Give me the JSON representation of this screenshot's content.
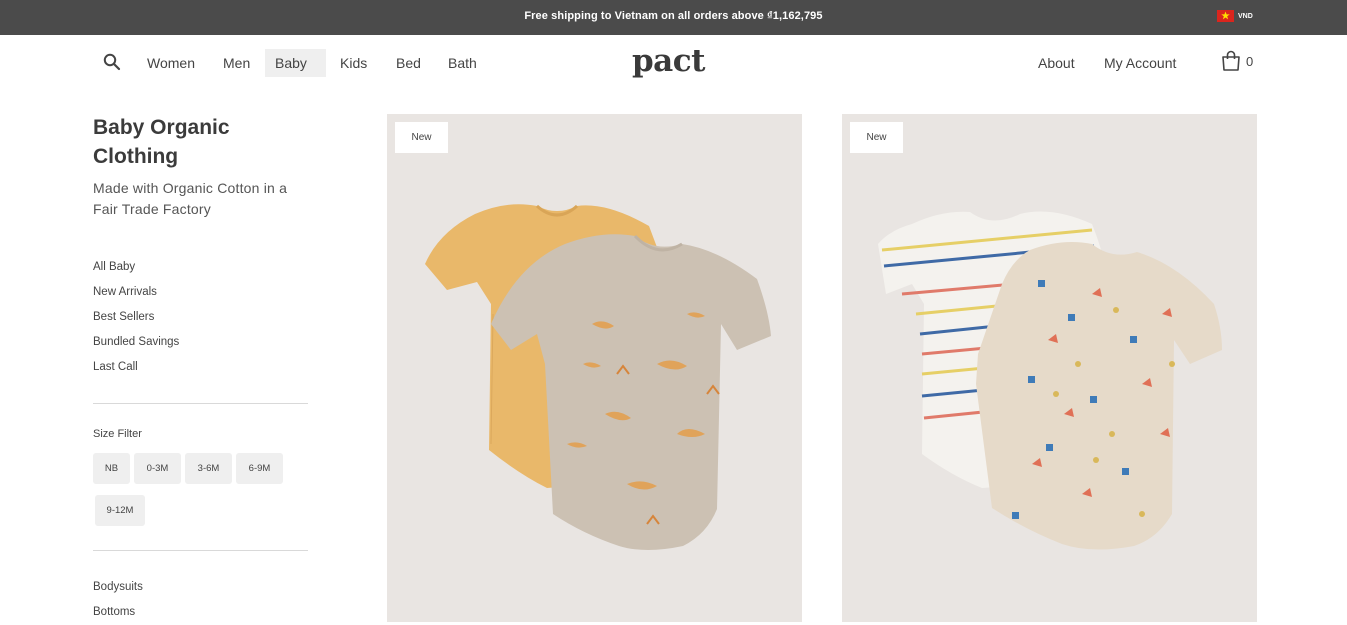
{
  "announcement": {
    "text": "Free shipping to Vietnam on all orders above ₫1,162,795",
    "currency": "VND"
  },
  "nav": {
    "left_items": [
      {
        "label": "Women"
      },
      {
        "label": "Men"
      },
      {
        "label": "Baby",
        "active": true
      },
      {
        "label": "Kids"
      },
      {
        "label": "Bed"
      },
      {
        "label": "Bath"
      }
    ],
    "logo": "pact",
    "about": "About",
    "account": "My Account",
    "cart_count": "0"
  },
  "sidebar": {
    "title": "Baby Organic Clothing",
    "subtitle": "Made with Organic Cotton in a Fair Trade Factory",
    "categories": [
      "All Baby",
      "New Arrivals",
      "Best Sellers",
      "Bundled Savings",
      "Last Call"
    ],
    "size_filter_label": "Size Filter",
    "sizes": [
      "NB",
      "0-3M",
      "3-6M",
      "6-9M",
      "9-12M"
    ],
    "sub_categories": [
      "Bodysuits",
      "Bottoms"
    ]
  },
  "products": [
    {
      "badge": "New",
      "colors": [
        "#e8b970",
        "#cbbfb1"
      ]
    },
    {
      "badge": "New",
      "colors": [
        "#f3f1ec",
        "#e6d9c8"
      ]
    }
  ],
  "colors": {
    "topbar_bg": "#4b4b4b",
    "card_bg": "#e9e5e2"
  }
}
